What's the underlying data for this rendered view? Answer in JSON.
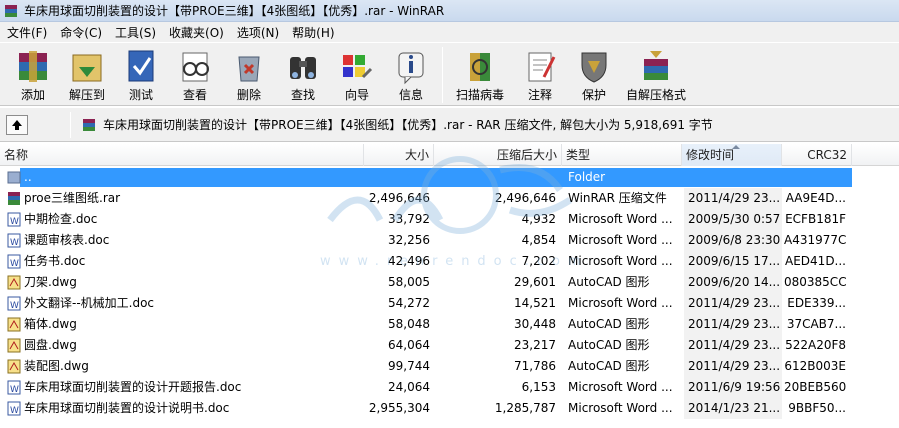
{
  "window": {
    "title": "车床用球面切削装置的设计【带PROE三维】【4张图纸】【优秀】.rar - WinRAR"
  },
  "menu": [
    {
      "label": "文件(F)"
    },
    {
      "label": "命令(C)"
    },
    {
      "label": "工具(S)"
    },
    {
      "label": "收藏夹(O)"
    },
    {
      "label": "选项(N)"
    },
    {
      "label": "帮助(H)"
    }
  ],
  "toolbar": [
    {
      "label": "添加",
      "icon": "add-books-icon"
    },
    {
      "label": "解压到",
      "icon": "extract-folder-icon"
    },
    {
      "label": "测试",
      "icon": "test-check-icon"
    },
    {
      "label": "查看",
      "icon": "view-glasses-icon"
    },
    {
      "label": "删除",
      "icon": "delete-recycle-icon"
    },
    {
      "label": "查找",
      "icon": "find-binoculars-icon"
    },
    {
      "label": "向导",
      "icon": "wizard-icon"
    },
    {
      "label": "信息",
      "icon": "info-icon"
    },
    {
      "label": "扫描病毒",
      "icon": "virus-scan-icon"
    },
    {
      "label": "注释",
      "icon": "comment-icon"
    },
    {
      "label": "保护",
      "icon": "protect-shield-icon"
    },
    {
      "label": "自解压格式",
      "icon": "sfx-icon"
    }
  ],
  "address": {
    "text": "车床用球面切削装置的设计【带PROE三维】【4张图纸】【优秀】.rar - RAR 压缩文件, 解包大小为 5,918,691 字节"
  },
  "columns": {
    "name": "名称",
    "size": "大小",
    "packed": "压缩后大小",
    "type": "类型",
    "modified": "修改时间",
    "crc": "CRC32"
  },
  "files": [
    {
      "name": "..",
      "size": "",
      "packed": "",
      "type": "Folder",
      "modified": "",
      "crc": "",
      "icon": "parent-folder-icon",
      "selected": true
    },
    {
      "name": "proe三维图纸.rar",
      "size": "2,496,646",
      "packed": "2,496,646",
      "type": "WinRAR 压缩文件",
      "modified": "2011/4/29 23...",
      "crc": "AA9E4D...",
      "icon": "rar-file-icon"
    },
    {
      "name": "中期检查.doc",
      "size": "33,792",
      "packed": "4,932",
      "type": "Microsoft Word ...",
      "modified": "2009/5/30 0:57",
      "crc": "ECFB181F",
      "icon": "doc-file-icon"
    },
    {
      "name": "课题审核表.doc",
      "size": "32,256",
      "packed": "4,854",
      "type": "Microsoft Word ...",
      "modified": "2009/6/8 23:30",
      "crc": "A431977C",
      "icon": "doc-file-icon"
    },
    {
      "name": "任务书.doc",
      "size": "42,496",
      "packed": "7,202",
      "type": "Microsoft Word ...",
      "modified": "2009/6/15 17...",
      "crc": "AED41D...",
      "icon": "doc-file-icon"
    },
    {
      "name": "刀架.dwg",
      "size": "58,005",
      "packed": "29,601",
      "type": "AutoCAD 图形",
      "modified": "2009/6/20 14...",
      "crc": "080385CC",
      "icon": "dwg-file-icon"
    },
    {
      "name": "外文翻译--机械加工.doc",
      "size": "54,272",
      "packed": "14,521",
      "type": "Microsoft Word ...",
      "modified": "2011/4/29 23...",
      "crc": "EDE339...",
      "icon": "doc-file-icon"
    },
    {
      "name": "箱体.dwg",
      "size": "58,048",
      "packed": "30,448",
      "type": "AutoCAD 图形",
      "modified": "2011/4/29 23...",
      "crc": "37CAB7...",
      "icon": "dwg-file-icon"
    },
    {
      "name": "圆盘.dwg",
      "size": "64,064",
      "packed": "23,217",
      "type": "AutoCAD 图形",
      "modified": "2011/4/29 23...",
      "crc": "522A20F8",
      "icon": "dwg-file-icon"
    },
    {
      "name": "装配图.dwg",
      "size": "99,744",
      "packed": "71,786",
      "type": "AutoCAD 图形",
      "modified": "2011/4/29 23...",
      "crc": "612B003E",
      "icon": "dwg-file-icon"
    },
    {
      "name": "车床用球面切削装置的设计开题报告.doc",
      "size": "24,064",
      "packed": "6,153",
      "type": "Microsoft Word ...",
      "modified": "2011/6/9 19:56",
      "crc": "20BEB560",
      "icon": "doc-file-icon"
    },
    {
      "name": "车床用球面切削装置的设计说明书.doc",
      "size": "2,955,304",
      "packed": "1,285,787",
      "type": "Microsoft Word ...",
      "modified": "2014/1/23 21...",
      "crc": "9BBF50...",
      "icon": "doc-file-icon"
    }
  ],
  "watermark": {
    "text": "www.renrendoc.com"
  }
}
